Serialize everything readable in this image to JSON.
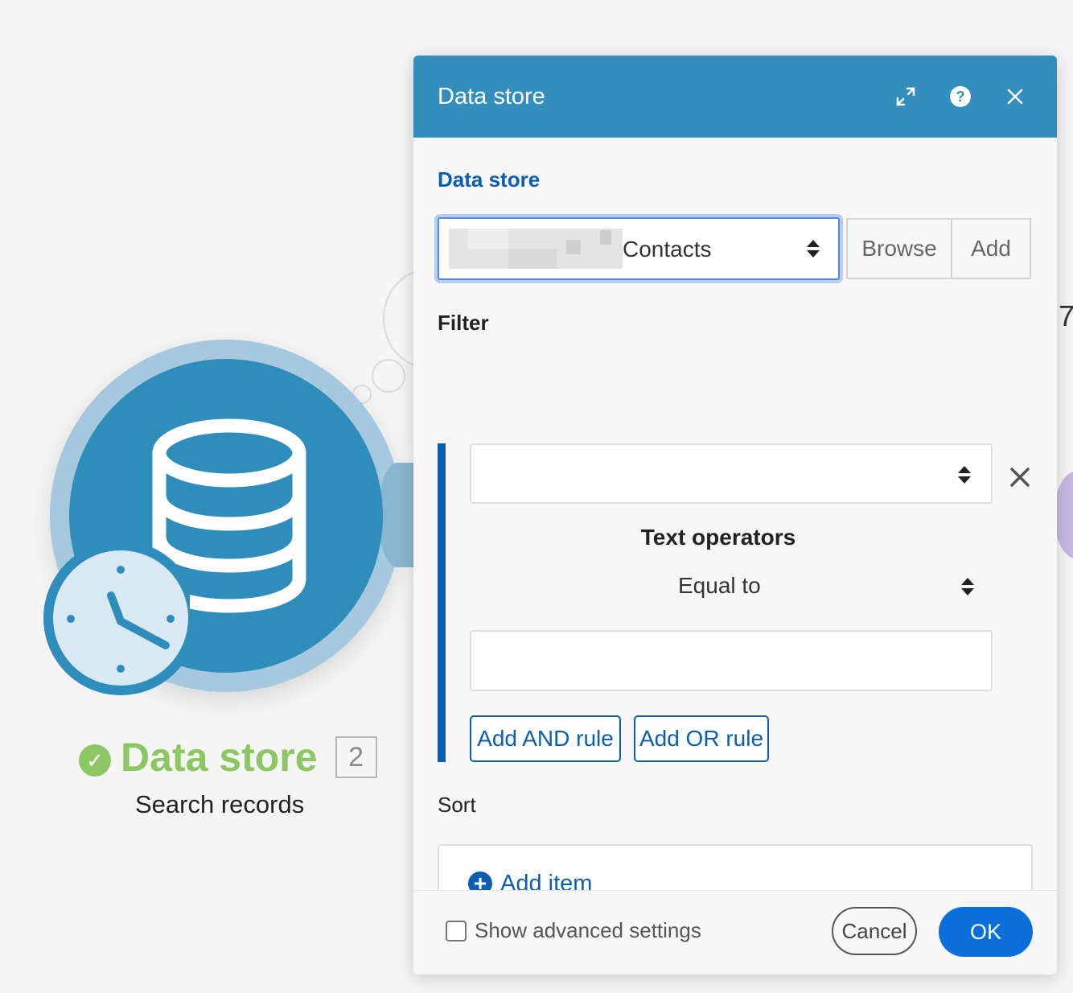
{
  "colors": {
    "header": "#338dbd",
    "primary": "#0c5eb3",
    "ok": "#0a6fdb",
    "success": "#8cc763",
    "module": "#2f8dbb"
  },
  "module": {
    "title": "Data store",
    "badge": "2",
    "subtitle": "Search records",
    "status": "success"
  },
  "side_digit": "7",
  "dialog": {
    "title": "Data store",
    "icons": [
      "expand-icon",
      "help-icon",
      "close-icon"
    ],
    "data_store_label": "Data store",
    "data_store_value": "Contacts",
    "browse_label": "Browse",
    "add_label": "Add",
    "filter_label": "Filter",
    "filter_field_value": "",
    "operators_title": "Text operators",
    "operator_value": "Equal to",
    "filter_value": "",
    "add_and_rule": "Add AND rule",
    "add_or_rule": "Add OR rule",
    "sort_label": "Sort",
    "add_item_label": "Add item",
    "advanced_label": "Show advanced settings",
    "advanced_checked": false,
    "cancel_label": "Cancel",
    "ok_label": "OK"
  }
}
